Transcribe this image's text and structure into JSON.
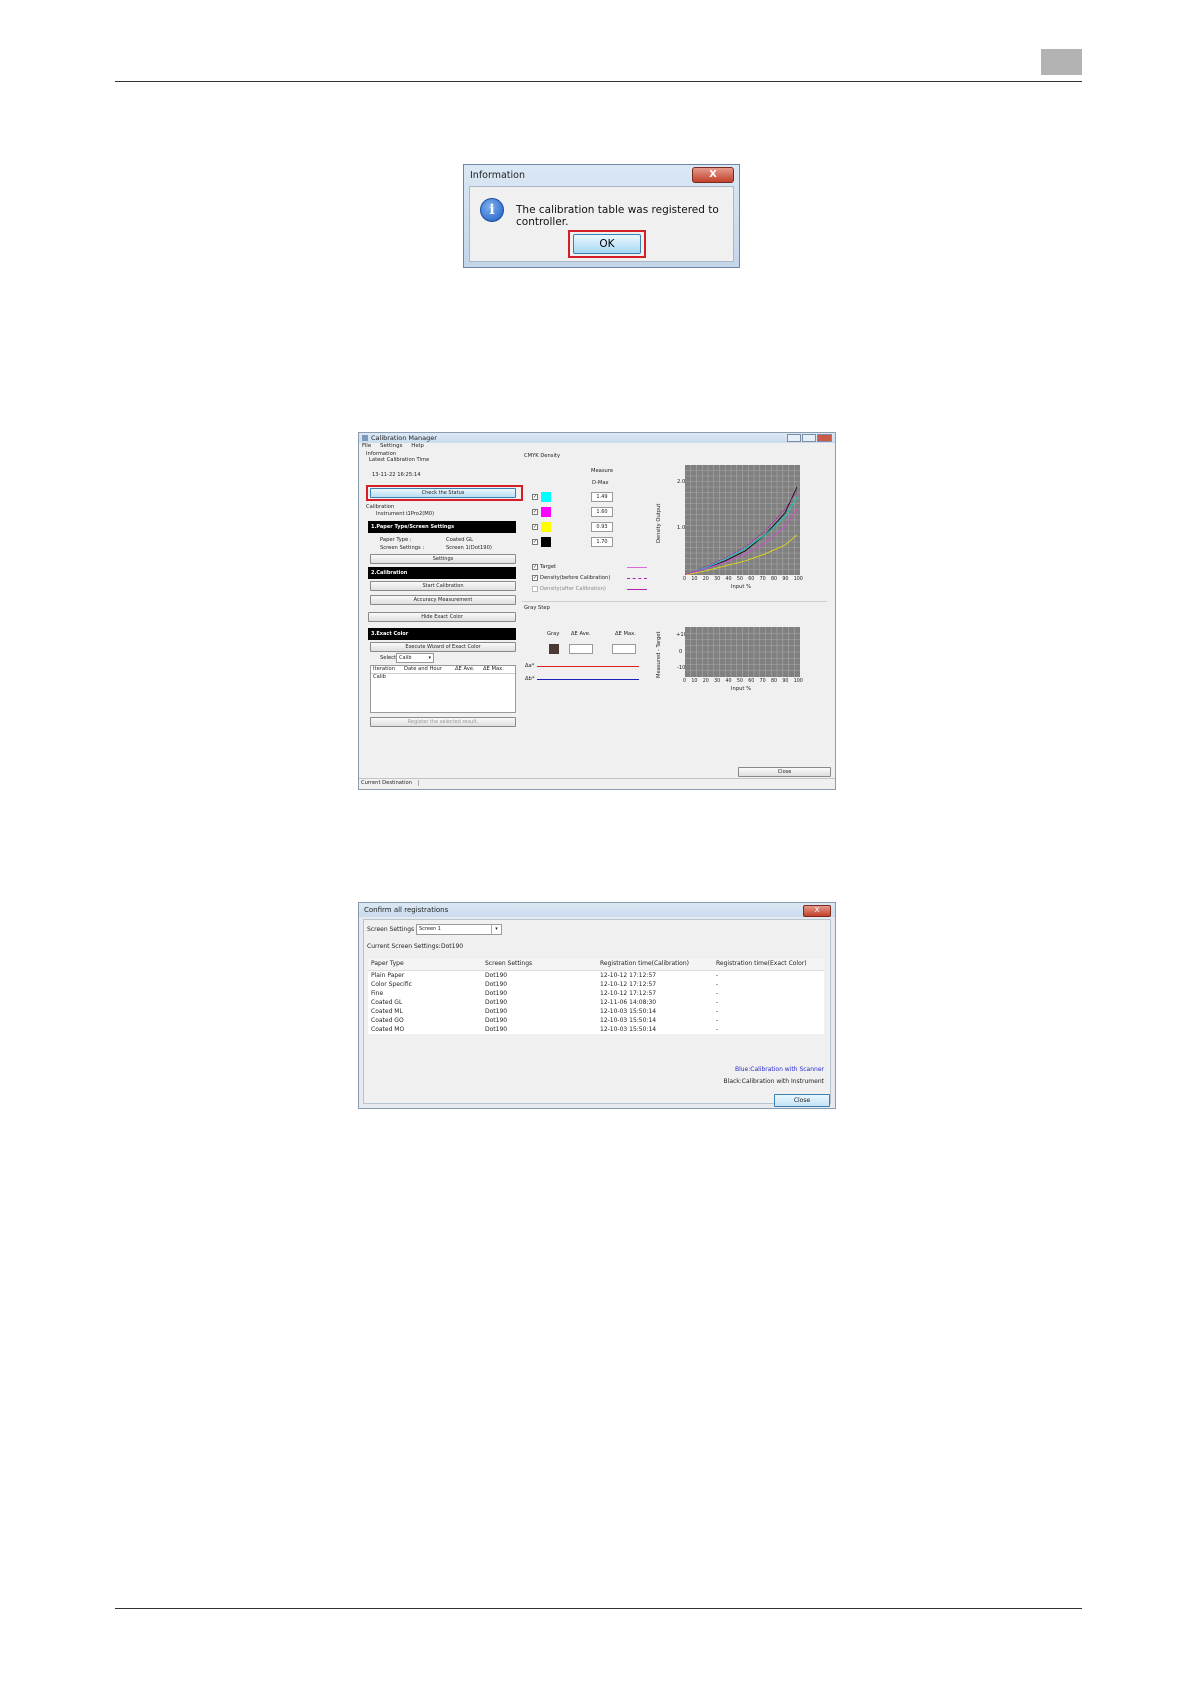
{
  "page": {
    "number": ""
  },
  "info_dialog": {
    "title": "Information",
    "close_glyph": "X",
    "message": "The calibration table was registered to controller.",
    "ok_label": "OK"
  },
  "calibration_manager": {
    "title": "Calibration Manager",
    "menu": [
      "File",
      "Settings",
      "Help"
    ],
    "information": {
      "heading": "Information",
      "latest_label": "Latest Calibration Time",
      "latest_value": "13-11-22 16:25:14",
      "check_status_button": "Check the Status",
      "calibration_heading": "Calibration",
      "instrument_label": "Instrument :",
      "instrument_value": "i1Pro2(M0)"
    },
    "section1": {
      "title": "1.Paper Type/Screen Settings",
      "paper_type_label": "Paper Type :",
      "paper_type_value": "Coated GL",
      "screen_label": "Screen Settings :",
      "screen_value": "Screen 1(Dot190)",
      "settings_button": "Settings"
    },
    "section2": {
      "title": "2.Calibration",
      "start_button": "Start Calibration",
      "accuracy_button": "Accuracy Measurement"
    },
    "hide_exact_button": "Hide Exact Color",
    "section3": {
      "title": "3.Exact Color",
      "wizard_button": "Execute Wizard of Exact Color",
      "select_label": "Select",
      "select_value": "Calib",
      "columns": [
        "Iteration",
        "Date and Hour",
        "ΔE Ave.",
        "ΔE Max."
      ],
      "first_row": "Calib",
      "register_button": "Register the selected result."
    },
    "density": {
      "heading": "CMYK Density",
      "measure_label": "Measure",
      "dmax_label": "D-Max",
      "values": [
        "1.49",
        "1.60",
        "0.93",
        "1.70"
      ],
      "swatch_colors": [
        "#00ffff",
        "#ff00ff",
        "#ffff00",
        "#000000"
      ],
      "legend": [
        "Target",
        "Density(before Calibration)",
        "Density(after Calibration)"
      ],
      "y_axis_label": "Density Output",
      "y_ticks": [
        "2.0",
        "1.0"
      ],
      "x_axis_label": "Input %",
      "x_ticks": [
        "0",
        "10",
        "20",
        "30",
        "40",
        "50",
        "60",
        "70",
        "80",
        "90",
        "100"
      ]
    },
    "gray_step": {
      "heading": "Gray Step",
      "gray_label": "Gray",
      "de_ave_label": "ΔE Ave.",
      "de_max_label": "ΔE Max.",
      "da_label": "Δa*",
      "db_label": "Δb*",
      "y_axis_label": "Measured - Target",
      "y_ticks": [
        "+10",
        "0",
        "-10"
      ],
      "x_axis_label": "Input %"
    },
    "close_button": "Close",
    "status_bar": "Current Destination"
  },
  "confirm_dialog": {
    "title": "Confirm all registrations",
    "close_glyph": "X",
    "screen_settings_label": "Screen Settings",
    "screen_settings_value": "Screen 1",
    "current_label": "Current Screen Settings:",
    "current_value": "Dot190",
    "columns": [
      "Paper Type",
      "Screen Settings",
      "Registration time(Calibration)",
      "Registration time(Exact Color)"
    ],
    "rows": [
      [
        "Plain Paper",
        "Dot190",
        "12-10-12 17:12:57",
        "-"
      ],
      [
        "Color Specific",
        "Dot190",
        "12-10-12 17:12:57",
        "-"
      ],
      [
        "Fine",
        "Dot190",
        "12-10-12 17:12:57",
        "-"
      ],
      [
        "Coated GL",
        "Dot190",
        "12-11-06 14:08:30",
        "-"
      ],
      [
        "Coated ML",
        "Dot190",
        "12-10-03 15:50:14",
        "-"
      ],
      [
        "Coated GO",
        "Dot190",
        "12-10-03 15:50:14",
        "-"
      ],
      [
        "Coated MO",
        "Dot190",
        "12-10-03 15:50:14",
        "-"
      ]
    ],
    "legend_blue": "Blue:Calibration with Scanner",
    "legend_black": "Black:Calibration with Instrument",
    "close_button": "Close"
  }
}
